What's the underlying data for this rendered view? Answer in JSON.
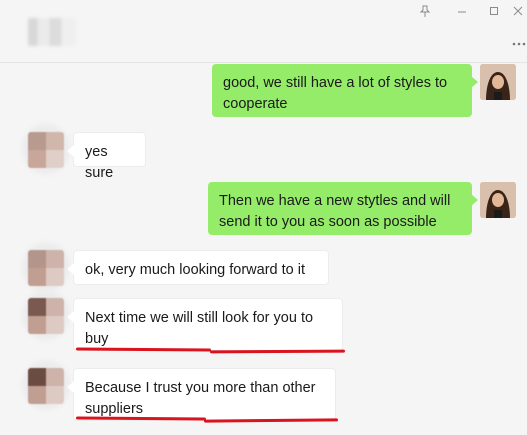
{
  "window": {
    "contact_name_blurred": true,
    "icons": [
      "pin-icon",
      "minimize-icon",
      "maximize-icon",
      "close-icon",
      "more-icon"
    ]
  },
  "messages": [
    {
      "id": 1,
      "sender": "me",
      "text": "good, we still have a lot of styles to cooperate"
    },
    {
      "id": 2,
      "sender": "other",
      "text": "yes sure"
    },
    {
      "id": 3,
      "sender": "me",
      "text": "Then we have a new stytles and will send it to you as soon as possible"
    },
    {
      "id": 4,
      "sender": "other",
      "text": "ok, very much looking forward to it"
    },
    {
      "id": 5,
      "sender": "other",
      "text": "Next time we will still look for you to buy",
      "highlighted": true
    },
    {
      "id": 6,
      "sender": "other",
      "text": "Because I trust you more than other suppliers",
      "highlighted": true
    }
  ],
  "colors": {
    "background": "#f5f5f5",
    "my_bubble": "#95ec69",
    "their_bubble": "#ffffff",
    "annotation": "#d9141e"
  }
}
